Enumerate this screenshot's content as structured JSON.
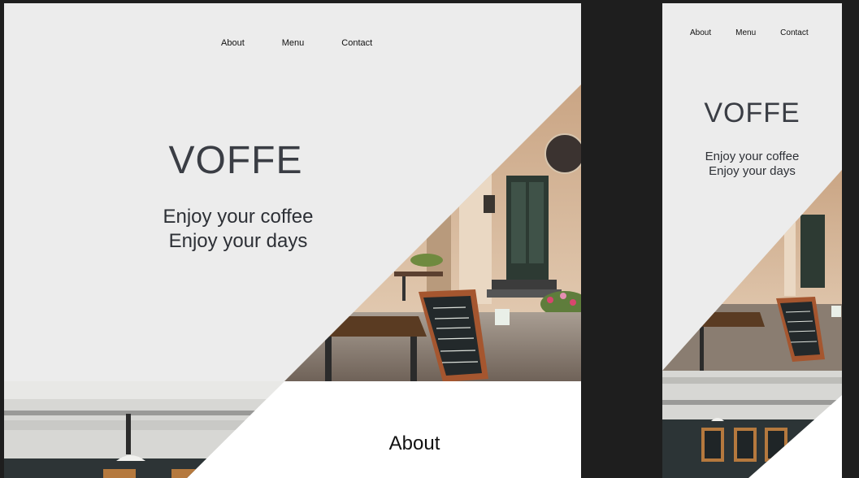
{
  "desktop": {
    "nav": {
      "about": "About",
      "menu": "Menu",
      "contact": "Contact"
    },
    "brand_title": "VOFFE",
    "tagline_line1": "Enjoy your coffee",
    "tagline_line2": "Enjoy your days",
    "about_heading": "About"
  },
  "mobile": {
    "nav": {
      "about": "About",
      "menu": "Menu",
      "contact": "Contact"
    },
    "brand_title": "VOFFE",
    "tagline_line1": "Enjoy your coffee",
    "tagline_line2": "Enjoy your days"
  }
}
